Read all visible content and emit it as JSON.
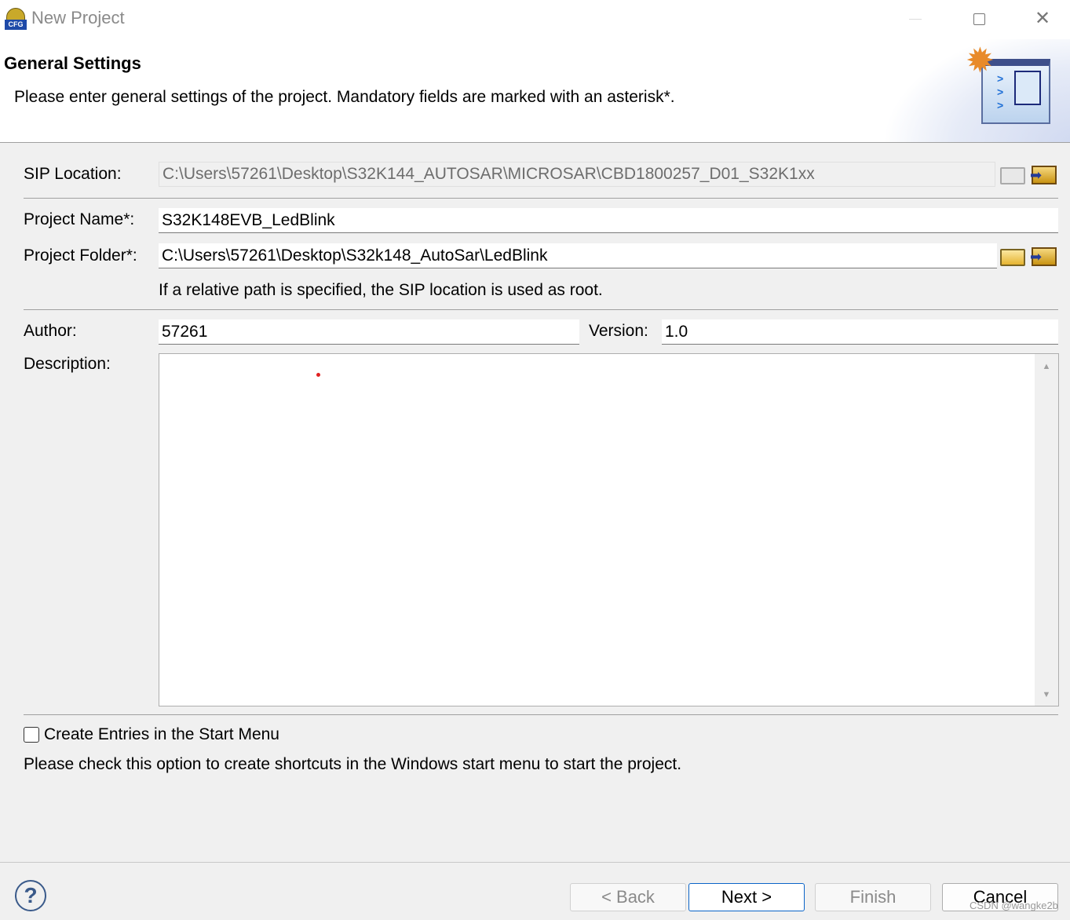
{
  "window": {
    "title": "New Project",
    "app_icon_text": "CFG"
  },
  "header": {
    "title": "General Settings",
    "description": "Please enter general settings of the project. Mandatory fields are marked with an asterisk*."
  },
  "form": {
    "sip_location": {
      "label": "SIP Location:",
      "value": "C:\\Users\\57261\\Desktop\\S32K144_AUTOSAR\\MICROSAR\\CBD1800257_D01_S32K1xx"
    },
    "project_name": {
      "label": "Project Name*:",
      "value": "S32K148EVB_LedBlink"
    },
    "project_folder": {
      "label": "Project Folder*:",
      "value": "C:\\Users\\57261\\Desktop\\S32k148_AutoSar\\LedBlink"
    },
    "folder_hint": "If a relative path is specified, the SIP location is used as root.",
    "author": {
      "label": "Author:",
      "value": "57261"
    },
    "version": {
      "label": "Version:",
      "value": "1.0"
    },
    "description": {
      "label": "Description:",
      "value": ""
    },
    "start_menu": {
      "label": "Create Entries in the Start Menu",
      "checked": false,
      "hint": "Please check this option to create shortcuts in the Windows start menu to start the project."
    }
  },
  "buttons": {
    "back": "< Back",
    "next": "Next >",
    "finish": "Finish",
    "cancel": "Cancel"
  },
  "watermark": "CSDN @wangke2b"
}
